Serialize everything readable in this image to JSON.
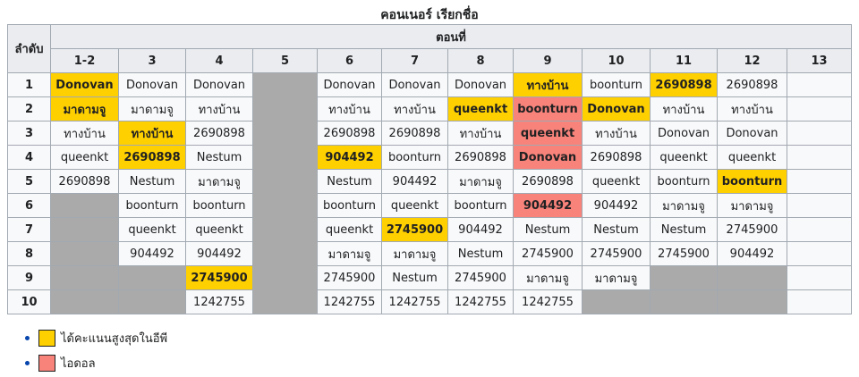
{
  "caption": "คอนเนอร์ เรียกชื่อ",
  "colors": {
    "winner": "#ffd000",
    "idol": "#f8837b",
    "eliminated": "#aaaaaa",
    "header": "#eaecf0",
    "cell": "#f8f9fa"
  },
  "header": {
    "rank_label": "ลำดับ",
    "episode_label": "ตอนที่",
    "episodes": [
      "1-2",
      "3",
      "4",
      "5",
      "6",
      "7",
      "8",
      "9",
      "10",
      "11",
      "12",
      "13"
    ]
  },
  "rows": [
    {
      "rank": "1",
      "cells": [
        {
          "t": "Donovan",
          "s": "win"
        },
        {
          "t": "Donovan",
          "s": ""
        },
        {
          "t": "Donovan",
          "s": ""
        },
        {
          "t": "",
          "s": "gray",
          "rowspan": 10
        },
        {
          "t": "Donovan",
          "s": ""
        },
        {
          "t": "Donovan",
          "s": ""
        },
        {
          "t": "Donovan",
          "s": ""
        },
        {
          "t": "ทางบ้าน",
          "s": "win"
        },
        {
          "t": "boonturn",
          "s": ""
        },
        {
          "t": "2690898",
          "s": "win"
        },
        {
          "t": "2690898",
          "s": ""
        },
        {
          "t": "",
          "s": "blank"
        }
      ]
    },
    {
      "rank": "2",
      "cells": [
        {
          "t": "มาดามจู",
          "s": "win"
        },
        {
          "t": "มาดามจู",
          "s": ""
        },
        {
          "t": "ทางบ้าน",
          "s": ""
        },
        {
          "t": "ทางบ้าน",
          "s": ""
        },
        {
          "t": "ทางบ้าน",
          "s": ""
        },
        {
          "t": "queenkt",
          "s": "win"
        },
        {
          "t": "boonturn",
          "s": "idol"
        },
        {
          "t": "Donovan",
          "s": "win"
        },
        {
          "t": "ทางบ้าน",
          "s": ""
        },
        {
          "t": "ทางบ้าน",
          "s": ""
        },
        {
          "t": "",
          "s": "blank"
        }
      ]
    },
    {
      "rank": "3",
      "cells": [
        {
          "t": "ทางบ้าน",
          "s": ""
        },
        {
          "t": "ทางบ้าน",
          "s": "win"
        },
        {
          "t": "2690898",
          "s": ""
        },
        {
          "t": "2690898",
          "s": ""
        },
        {
          "t": "2690898",
          "s": ""
        },
        {
          "t": "ทางบ้าน",
          "s": ""
        },
        {
          "t": "queenkt",
          "s": "idol"
        },
        {
          "t": "ทางบ้าน",
          "s": ""
        },
        {
          "t": "Donovan",
          "s": ""
        },
        {
          "t": "Donovan",
          "s": ""
        },
        {
          "t": "",
          "s": "blank"
        }
      ]
    },
    {
      "rank": "4",
      "cells": [
        {
          "t": "queenkt",
          "s": ""
        },
        {
          "t": "2690898",
          "s": "win"
        },
        {
          "t": "Nestum",
          "s": ""
        },
        {
          "t": "904492",
          "s": "win"
        },
        {
          "t": "boonturn",
          "s": ""
        },
        {
          "t": "2690898",
          "s": ""
        },
        {
          "t": "Donovan",
          "s": "idol"
        },
        {
          "t": "2690898",
          "s": ""
        },
        {
          "t": "queenkt",
          "s": ""
        },
        {
          "t": "queenkt",
          "s": ""
        },
        {
          "t": "",
          "s": "blank"
        }
      ]
    },
    {
      "rank": "5",
      "cells": [
        {
          "t": "2690898",
          "s": ""
        },
        {
          "t": "Nestum",
          "s": ""
        },
        {
          "t": "มาดามจู",
          "s": ""
        },
        {
          "t": "Nestum",
          "s": ""
        },
        {
          "t": "904492",
          "s": ""
        },
        {
          "t": "มาดามจู",
          "s": ""
        },
        {
          "t": "2690898",
          "s": ""
        },
        {
          "t": "queenkt",
          "s": ""
        },
        {
          "t": "boonturn",
          "s": ""
        },
        {
          "t": "boonturn",
          "s": "win"
        },
        {
          "t": "",
          "s": "blank"
        }
      ]
    },
    {
      "rank": "6",
      "cells": [
        {
          "t": "",
          "s": "gray"
        },
        {
          "t": "boonturn",
          "s": ""
        },
        {
          "t": "boonturn",
          "s": ""
        },
        {
          "t": "boonturn",
          "s": ""
        },
        {
          "t": "queenkt",
          "s": ""
        },
        {
          "t": "boonturn",
          "s": ""
        },
        {
          "t": "904492",
          "s": "idol"
        },
        {
          "t": "904492",
          "s": ""
        },
        {
          "t": "มาดามจู",
          "s": ""
        },
        {
          "t": "มาดามจู",
          "s": ""
        },
        {
          "t": "",
          "s": "blank"
        }
      ]
    },
    {
      "rank": "7",
      "cells": [
        {
          "t": "",
          "s": "gray"
        },
        {
          "t": "queenkt",
          "s": ""
        },
        {
          "t": "queenkt",
          "s": ""
        },
        {
          "t": "queenkt",
          "s": ""
        },
        {
          "t": "2745900",
          "s": "win"
        },
        {
          "t": "904492",
          "s": ""
        },
        {
          "t": "Nestum",
          "s": ""
        },
        {
          "t": "Nestum",
          "s": ""
        },
        {
          "t": "Nestum",
          "s": ""
        },
        {
          "t": "2745900",
          "s": ""
        },
        {
          "t": "",
          "s": "blank"
        }
      ]
    },
    {
      "rank": "8",
      "cells": [
        {
          "t": "",
          "s": "gray"
        },
        {
          "t": "904492",
          "s": ""
        },
        {
          "t": "904492",
          "s": ""
        },
        {
          "t": "มาดามจู",
          "s": ""
        },
        {
          "t": "มาดามจู",
          "s": ""
        },
        {
          "t": "Nestum",
          "s": ""
        },
        {
          "t": "2745900",
          "s": ""
        },
        {
          "t": "2745900",
          "s": ""
        },
        {
          "t": "2745900",
          "s": ""
        },
        {
          "t": "904492",
          "s": ""
        },
        {
          "t": "",
          "s": "blank"
        }
      ]
    },
    {
      "rank": "9",
      "cells": [
        {
          "t": "",
          "s": "gray"
        },
        {
          "t": "",
          "s": "gray"
        },
        {
          "t": "2745900",
          "s": "win"
        },
        {
          "t": "2745900",
          "s": ""
        },
        {
          "t": "Nestum",
          "s": ""
        },
        {
          "t": "2745900",
          "s": ""
        },
        {
          "t": "มาดามจู",
          "s": ""
        },
        {
          "t": "มาดามจู",
          "s": ""
        },
        {
          "t": "",
          "s": "gray"
        },
        {
          "t": "",
          "s": "gray"
        },
        {
          "t": "",
          "s": "blank"
        }
      ]
    },
    {
      "rank": "10",
      "cells": [
        {
          "t": "",
          "s": "gray"
        },
        {
          "t": "",
          "s": "gray"
        },
        {
          "t": "1242755",
          "s": ""
        },
        {
          "t": "1242755",
          "s": ""
        },
        {
          "t": "1242755",
          "s": ""
        },
        {
          "t": "1242755",
          "s": ""
        },
        {
          "t": "1242755",
          "s": ""
        },
        {
          "t": "",
          "s": "gray"
        },
        {
          "t": "",
          "s": "gray"
        },
        {
          "t": "",
          "s": "gray"
        },
        {
          "t": "",
          "s": "blank"
        }
      ]
    }
  ],
  "legend": [
    {
      "label": "ได้คะแนนสูงสุดในอีพี",
      "color": "#ffd000"
    },
    {
      "label": "ไอดอล",
      "color": "#f8837b"
    }
  ]
}
